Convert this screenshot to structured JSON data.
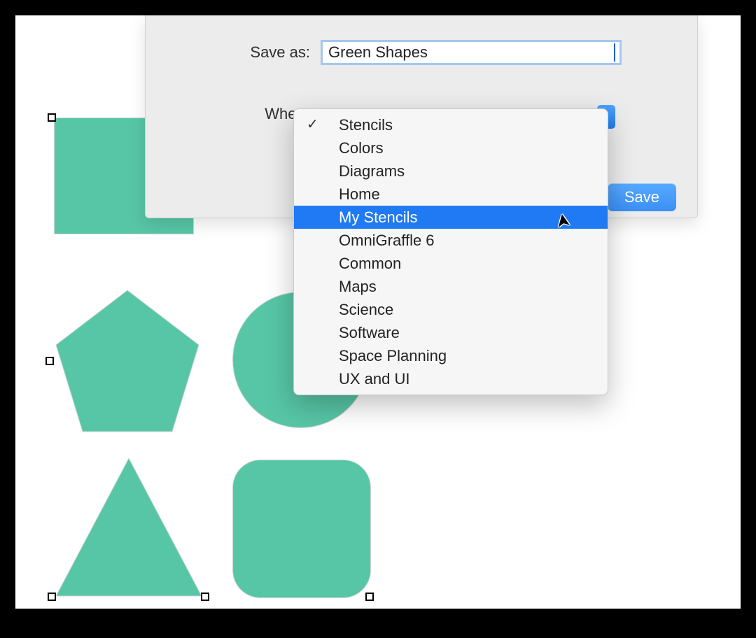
{
  "sheet": {
    "saveas_label": "Save as:",
    "filename_value": "Green Shapes",
    "where_label": "Where",
    "save_button": "Save"
  },
  "where_dropdown": {
    "selected": "Stencils",
    "highlighted": "My Stencils",
    "items": [
      "Stencils",
      "Colors",
      "Diagrams",
      "Home",
      "My Stencils",
      "OmniGraffle 6",
      "Common",
      "Maps",
      "Science",
      "Software",
      "Space Planning",
      "UX and UI"
    ]
  },
  "canvas": {
    "shape_color": "#57c6a6",
    "shapes": [
      "square",
      "pentagon",
      "circle",
      "triangle",
      "rounded-rectangle"
    ]
  }
}
